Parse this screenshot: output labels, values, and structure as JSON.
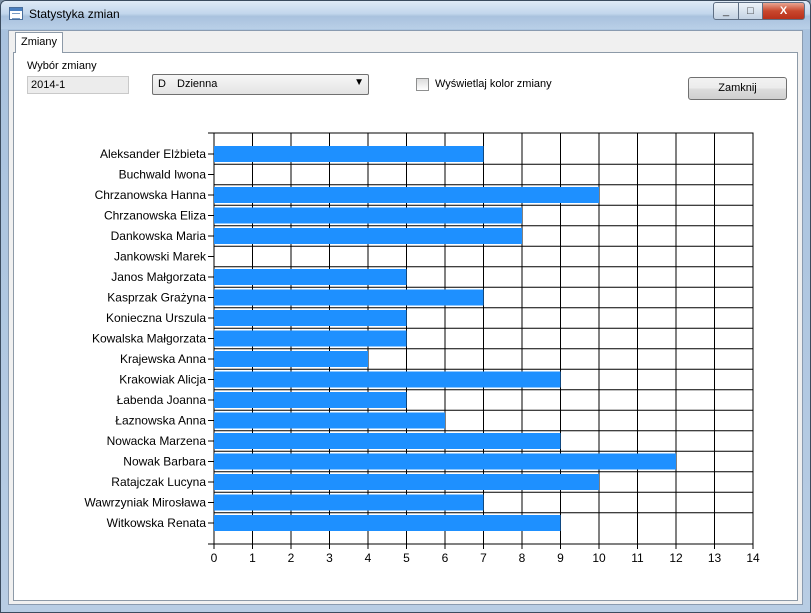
{
  "window": {
    "title": "Statystyka zmian"
  },
  "tabs": [
    {
      "label": "Zmiany"
    }
  ],
  "controls": {
    "group_label": "Wybór zmiany",
    "shift_id": "2014-1",
    "shift_code": "D",
    "shift_name": "Dzienna",
    "show_color_label": "Wyświetlaj kolor zmiany",
    "show_color_checked": false,
    "close_button": "Zamknij"
  },
  "window_buttons": {
    "minimize": "_",
    "maximize": "□",
    "close": "X"
  },
  "chart_data": {
    "type": "bar",
    "orientation": "horizontal",
    "color": "#1e90ff",
    "categories": [
      "Aleksander Elżbieta",
      "Buchwald Iwona",
      "Chrzanowska Hanna",
      "Chrzanowska Eliza",
      "Dankowska Maria",
      "Jankowski Marek",
      "Janos Małgorzata",
      "Kasprzak Grażyna",
      "Konieczna Urszula",
      "Kowalska Małgorzata",
      "Krajewska Anna",
      "Krakowiak Alicja",
      "Łabenda Joanna",
      "Łaznowska Anna",
      "Nowacka Marzena",
      "Nowak Barbara",
      "Ratajczak Lucyna",
      "Wawrzyniak Mirosława",
      "Witkowska Renata"
    ],
    "values": [
      7,
      0,
      10,
      8,
      8,
      0,
      5,
      7,
      5,
      5,
      4,
      9,
      5,
      6,
      9,
      12,
      10,
      7,
      9
    ],
    "xlim": [
      0,
      14
    ],
    "xticks": [
      "0",
      "1",
      "2",
      "3",
      "4",
      "5",
      "6",
      "7",
      "8",
      "9",
      "10",
      "11",
      "12",
      "13",
      "14"
    ],
    "grid": true
  }
}
